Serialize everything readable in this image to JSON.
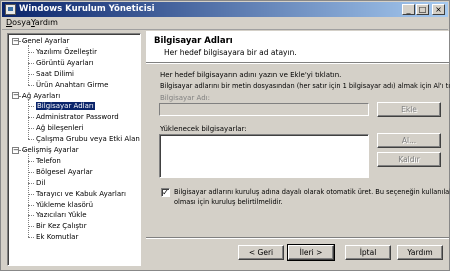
{
  "window": {
    "title": "Windows Kurulum Yöneticisi",
    "minimize_glyph": "_",
    "maximize_glyph": "□",
    "close_glyph": "×"
  },
  "menu": [
    "Dosya",
    "Yardım"
  ],
  "tree": [
    {
      "label": "Genel Ayarlar",
      "level": 0,
      "expander": "−"
    },
    {
      "label": "Yazılımı Özelleştir",
      "level": 1
    },
    {
      "label": "Görüntü Ayarları",
      "level": 1
    },
    {
      "label": "Saat Dilimi",
      "level": 1
    },
    {
      "label": "Ürün Anahtarı Girme",
      "level": 1
    },
    {
      "label": "Ağ Ayarları",
      "level": 0,
      "expander": "−"
    },
    {
      "label": "Bilgisayar Adları",
      "level": 1,
      "selected": true
    },
    {
      "label": "Administrator Password",
      "level": 1
    },
    {
      "label": "Ağ bileşenleri",
      "level": 1
    },
    {
      "label": "Çalışma Grubu veya Etki Alanı",
      "level": 1
    },
    {
      "label": "Gelişmiş Ayarlar",
      "level": 0,
      "expander": "−"
    },
    {
      "label": "Telefon",
      "level": 1
    },
    {
      "label": "Bölgesel Ayarlar",
      "level": 1
    },
    {
      "label": "Dil",
      "level": 1
    },
    {
      "label": "Tarayıcı ve Kabuk Ayarları",
      "level": 1
    },
    {
      "label": "Yükleme klasörü",
      "level": 1
    },
    {
      "label": "Yazıcıları Yükle",
      "level": 1
    },
    {
      "label": "Bir Kez Çalıştır",
      "level": 1
    },
    {
      "label": "Ek Komutlar",
      "level": 1
    }
  ],
  "page": {
    "title": "Bilgisayar Adları",
    "subtitle": "Her hedef bilgisayara bir ad atayın.",
    "instruction1": "Her hedef bilgisayarın adını yazın ve Ekle'yi tıklatın.",
    "instruction2": "Bilgisayar adlarını bir metin dosyasından (her satır için 1 bilgisayar adı) almak için Al'ı tıklatın.",
    "name_label": "Bilgisayar Adı:",
    "name_value": "",
    "add_button": "Ekle",
    "list_label": "Yüklenecek bilgisayarlar:",
    "import_button": "Al...",
    "remove_button": "Kaldır",
    "checkbox_checked": true,
    "checkbox_text1": "Bilgisayar adlarını kuruluş adına dayalı olarak otomatik üret. Bu seçeneğin kullanılabilir",
    "checkbox_text2": "olması için kuruluş belirtilmelidir."
  },
  "footer": {
    "back": "< Geri",
    "next": "İleri >",
    "cancel": "İptal",
    "help": "Yardım"
  }
}
